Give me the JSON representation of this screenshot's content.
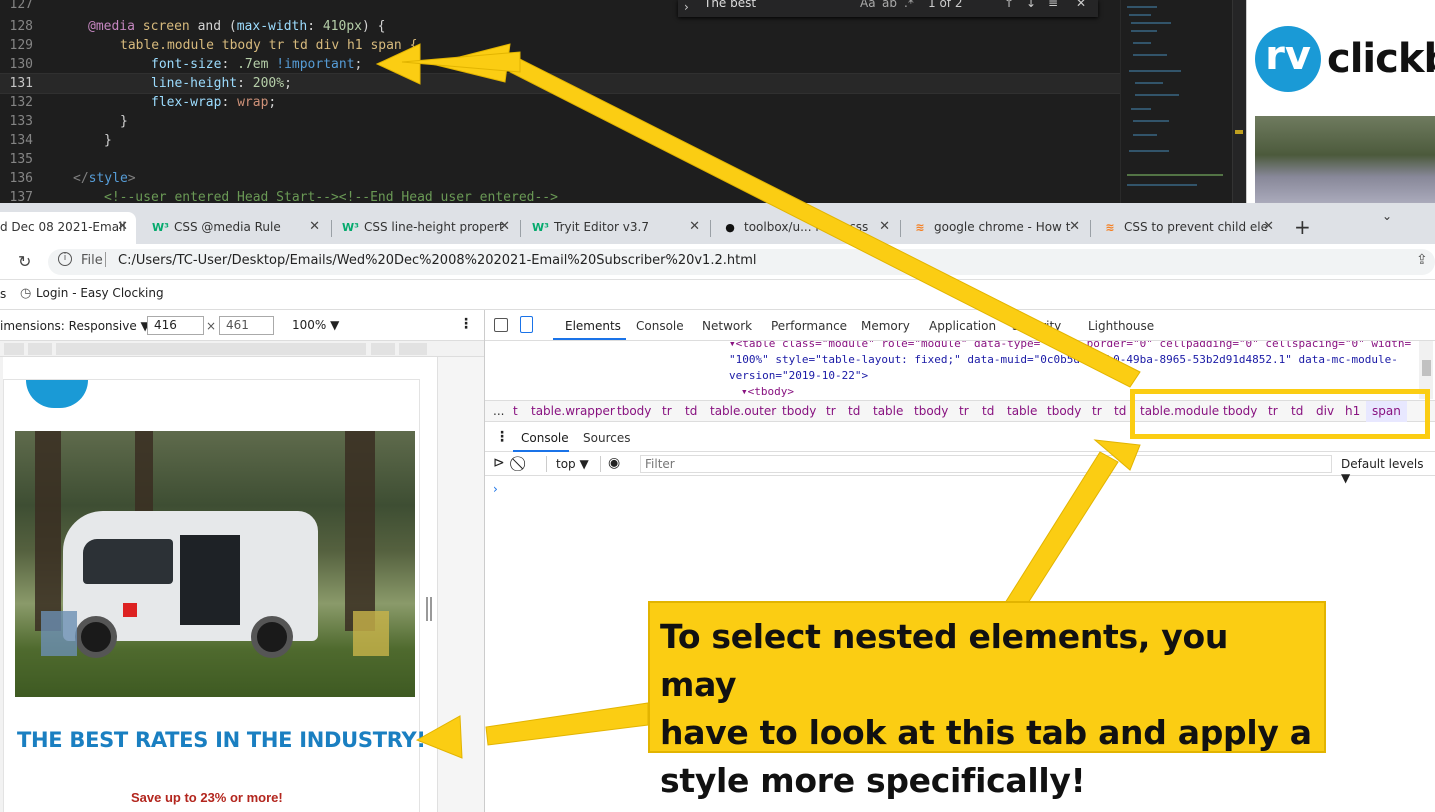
{
  "editor": {
    "find_widget": {
      "query": "The best",
      "result": "1 of 2"
    },
    "lines": [
      {
        "num": "127",
        "text": ""
      },
      {
        "num": "128",
        "text": "@media screen and (max-width: 410px) {"
      },
      {
        "num": "129",
        "text": "table.module tbody tr td div h1 span {"
      },
      {
        "num": "130",
        "text": "font-size: .7em !important;"
      },
      {
        "num": "131",
        "text": "line-height: 200%;"
      },
      {
        "num": "132",
        "text": "flex-wrap: wrap;"
      },
      {
        "num": "133",
        "text": "}"
      },
      {
        "num": "134",
        "text": "}"
      },
      {
        "num": "135",
        "text": ""
      },
      {
        "num": "136",
        "text": "</style>"
      },
      {
        "num": "137",
        "text": "<!--user entered Head Start--><!--End Head user entered-->"
      }
    ],
    "preview_logo": {
      "badge": "rv",
      "text": "clickb"
    }
  },
  "browser": {
    "tabs": [
      {
        "label": "d Dec 08 2021-Email",
        "icon": "page-icon",
        "active": true
      },
      {
        "label": "CSS @media Rule",
        "icon": "w3schools-icon",
        "active": false
      },
      {
        "label": "CSS line-height propert",
        "icon": "w3schools-icon",
        "active": false
      },
      {
        "label": "Tryit Editor v3.7",
        "icon": "w3schools-icon",
        "active": false
      },
      {
        "label": "toolbox/u... rems.css",
        "icon": "github-icon",
        "active": false
      },
      {
        "label": "google chrome - How t",
        "icon": "stackoverflow-icon",
        "active": false
      },
      {
        "label": "CSS to prevent child ele",
        "icon": "stackoverflow-icon",
        "active": false
      }
    ],
    "close_glyph": "✕",
    "new_tab": "+",
    "address": {
      "scheme_label": "File",
      "url": "C:/Users/TC-User/Desktop/Emails/Wed%20Dec%2008%202021-Email%20Subscriber%20v1.2.html"
    },
    "bookmarks": [
      {
        "label": "Login - Easy Clocking"
      }
    ],
    "bookmark_fragment": "s"
  },
  "device_toolbar": {
    "dimensions_label": "imensions: Responsive ▼",
    "width": "416",
    "height": "461",
    "zoom": "100% ▼",
    "times": "×"
  },
  "email": {
    "headline": "THE BEST RATES IN THE INDUSTRY!",
    "subline": "Save up to 23% or more!"
  },
  "devtools": {
    "tabs": [
      "Elements",
      "Console",
      "Network",
      "Performance",
      "Memory",
      "Application",
      "Security",
      "Lighthouse"
    ],
    "dom_lines": [
      "▾<table class=\"module\" role=\"module\" data-type=\"text\" border=\"0\" cellpadding=\"0\" cellspacing=\"0\" width=",
      "\"100%\" style=\"table-layout: fixed;\" data-muid=\"0c0b5d6-e2b0-49ba-8965-53b2d91d4852.1\" data-mc-module-",
      "version=\"2019-10-22\">",
      "▾<tbody>"
    ],
    "breadcrumbs": [
      "...",
      "t",
      "table.wrapper",
      "tbody",
      "tr",
      "td",
      "table.outer",
      "tbody",
      "tr",
      "td",
      "table",
      "tbody",
      "tr",
      "td",
      "table",
      "tbody",
      "tr",
      "td",
      "table.module",
      "tbody",
      "tr",
      "td",
      "div",
      "h1",
      "span"
    ],
    "drawer_tabs": [
      "Console",
      "Sources"
    ],
    "console_context": "top ▼",
    "filter_placeholder": "Filter",
    "levels": "Default levels ▼",
    "prompt": "›"
  },
  "annotation": {
    "callout_lines": [
      "To select nested elements, you may",
      "have to look at this tab and apply a",
      "style more specifically!"
    ],
    "color": "#fbcd13"
  }
}
